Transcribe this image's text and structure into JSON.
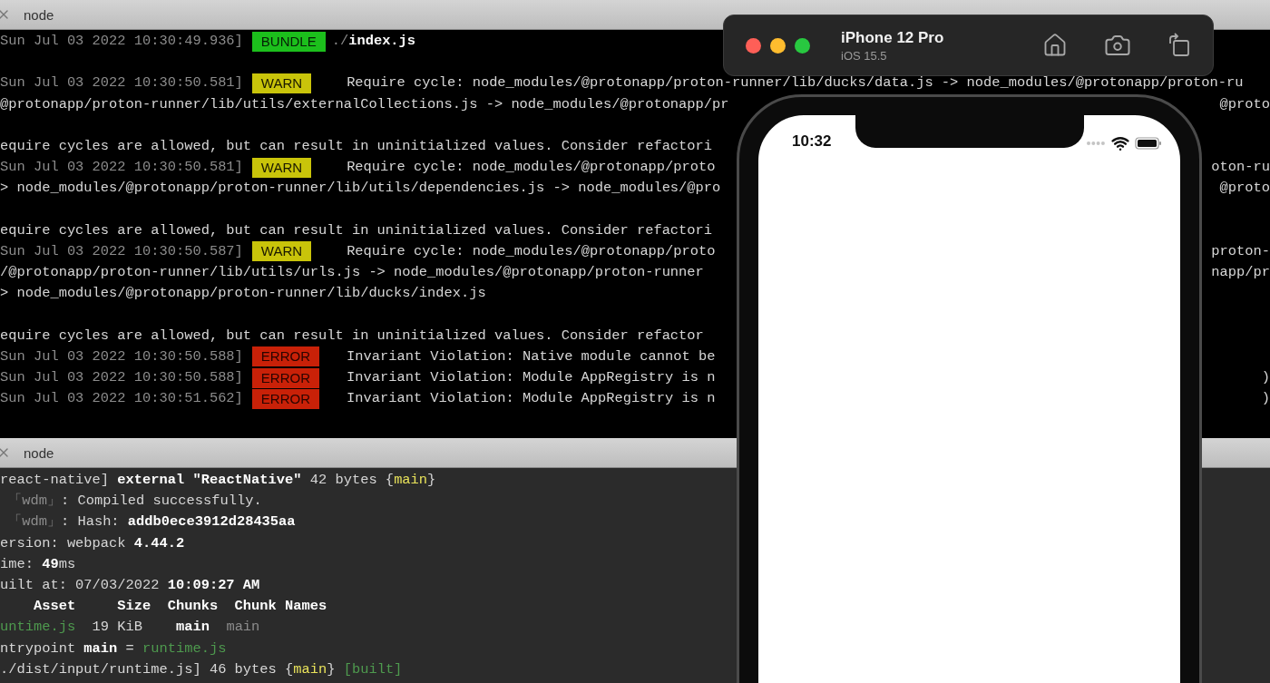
{
  "log_pane": {
    "tab": "node",
    "lines": [
      {
        "kind": "log",
        "time": "Sun Jul 03 2022 10:30:49.936]",
        "badge": {
          "label": "BUNDLE",
          "kind": "bundle"
        },
        "segments": [
          {
            "text": "./",
            "kind": "dim"
          },
          {
            "text": "index.js",
            "kind": "bold"
          }
        ]
      },
      {
        "kind": "blank"
      },
      {
        "kind": "log",
        "time": "Sun Jul 03 2022 10:30:50.581]",
        "badge": {
          "label": "WARN",
          "kind": "warn"
        },
        "segments": [
          {
            "text": "Require cycle: node_modules/@protonapp/proton-runner/lib/ducks/data.js -> node_modules/@protonapp/proton-ru",
            "kind": "plain"
          }
        ]
      },
      {
        "kind": "text",
        "segments": [
          {
            "text": "@protonapp/proton-runner/lib/utils/externalCollections.js -> node_modules/@protonapp/pr",
            "kind": "plain"
          }
        ],
        "tail": "@proto"
      },
      {
        "kind": "blank"
      },
      {
        "kind": "text",
        "segments": [
          {
            "text": "equire cycles are allowed, but can result in uninitialized values. Consider refactori",
            "kind": "plain"
          }
        ]
      },
      {
        "kind": "log",
        "time": "Sun Jul 03 2022 10:30:50.581]",
        "badge": {
          "label": "WARN",
          "kind": "warn"
        },
        "segments": [
          {
            "text": "Require cycle: node_modules/@protonapp/proto",
            "kind": "plain"
          }
        ],
        "tail": "oton-ru"
      },
      {
        "kind": "text",
        "segments": [
          {
            "text": "> node_modules/@protonapp/proton-runner/lib/utils/dependencies.js -> node_modules/@pro",
            "kind": "plain"
          }
        ],
        "tail": "@proto"
      },
      {
        "kind": "blank"
      },
      {
        "kind": "text",
        "segments": [
          {
            "text": "equire cycles are allowed, but can result in uninitialized values. Consider refactori",
            "kind": "plain"
          }
        ]
      },
      {
        "kind": "log",
        "time": "Sun Jul 03 2022 10:30:50.587]",
        "badge": {
          "label": "WARN",
          "kind": "warn"
        },
        "segments": [
          {
            "text": "Require cycle: node_modules/@protonapp/proto",
            "kind": "plain"
          }
        ],
        "tail": "proton-"
      },
      {
        "kind": "text",
        "segments": [
          {
            "text": "/@protonapp/proton-runner/lib/utils/urls.js -> node_modules/@protonapp/proton-runner",
            "kind": "plain"
          }
        ],
        "tail": "napp/pr"
      },
      {
        "kind": "text",
        "segments": [
          {
            "text": "> node_modules/@protonapp/proton-runner/lib/ducks/index.js",
            "kind": "plain"
          }
        ]
      },
      {
        "kind": "blank"
      },
      {
        "kind": "text",
        "segments": [
          {
            "text": "equire cycles are allowed, but can result in uninitialized values. Consider refactor",
            "kind": "plain"
          }
        ]
      },
      {
        "kind": "log",
        "time": "Sun Jul 03 2022 10:30:50.588]",
        "badge": {
          "label": "ERROR",
          "kind": "error"
        },
        "segments": [
          {
            "text": "Invariant Violation: Native module cannot be",
            "kind": "plain"
          }
        ]
      },
      {
        "kind": "log",
        "time": "Sun Jul 03 2022 10:30:50.588]",
        "badge": {
          "label": "ERROR",
          "kind": "error"
        },
        "segments": [
          {
            "text": "Invariant Violation: Module AppRegistry is n",
            "kind": "plain"
          }
        ],
        "tail": ")"
      },
      {
        "kind": "log",
        "time": "Sun Jul 03 2022 10:30:51.562]",
        "badge": {
          "label": "ERROR",
          "kind": "error"
        },
        "segments": [
          {
            "text": "Invariant Violation: Module AppRegistry is n",
            "kind": "plain"
          }
        ],
        "tail": ")"
      }
    ]
  },
  "build_pane": {
    "tab": "node",
    "lines": [
      {
        "segments": [
          {
            "text": "react-native] ",
            "kind": "plain"
          },
          {
            "text": "external \"ReactNative\"",
            "kind": "bold"
          },
          {
            "text": " 42 bytes {",
            "kind": "plain"
          },
          {
            "text": "main",
            "kind": "yellow"
          },
          {
            "text": "}",
            "kind": "plain"
          }
        ]
      },
      {
        "segments": [
          {
            "text": " 「wdm」",
            "kind": "dim"
          },
          {
            "text": ": Compiled successfully.",
            "kind": "plain"
          }
        ]
      },
      {
        "segments": [
          {
            "text": " 「wdm」",
            "kind": "dim"
          },
          {
            "text": ": Hash: ",
            "kind": "plain"
          },
          {
            "text": "addb0ece3912d28435aa",
            "kind": "bold"
          }
        ]
      },
      {
        "segments": [
          {
            "text": "ersion: webpack ",
            "kind": "plain"
          },
          {
            "text": "4.44.2",
            "kind": "bold"
          }
        ]
      },
      {
        "segments": [
          {
            "text": "ime: ",
            "kind": "plain"
          },
          {
            "text": "49",
            "kind": "bold"
          },
          {
            "text": "ms",
            "kind": "plain"
          }
        ]
      },
      {
        "segments": [
          {
            "text": "uilt at: 07/03/2022 ",
            "kind": "plain"
          },
          {
            "text": "10:09:27 AM",
            "kind": "bold"
          }
        ]
      },
      {
        "segments": [
          {
            "text": "    Asset     Size  Chunks  Chunk Names",
            "kind": "bold"
          }
        ]
      },
      {
        "segments": [
          {
            "text": "untime.js",
            "kind": "green"
          },
          {
            "text": "  19 KiB    ",
            "kind": "plain"
          },
          {
            "text": "main",
            "kind": "bold"
          },
          {
            "text": "  main",
            "kind": "dim"
          }
        ]
      },
      {
        "segments": [
          {
            "text": "ntrypoint ",
            "kind": "plain"
          },
          {
            "text": "main",
            "kind": "bold"
          },
          {
            "text": " = ",
            "kind": "plain"
          },
          {
            "text": "runtime.js",
            "kind": "green"
          }
        ]
      },
      {
        "segments": [
          {
            "text": "./dist/input/runtime.js] 46 bytes {",
            "kind": "plain"
          },
          {
            "text": "main",
            "kind": "yellow"
          },
          {
            "text": "} ",
            "kind": "plain"
          },
          {
            "text": "[built]",
            "kind": "green"
          }
        ]
      }
    ]
  },
  "simulator": {
    "device": "iPhone 12 Pro",
    "os": "iOS 15.5",
    "status_time": "10:32"
  }
}
